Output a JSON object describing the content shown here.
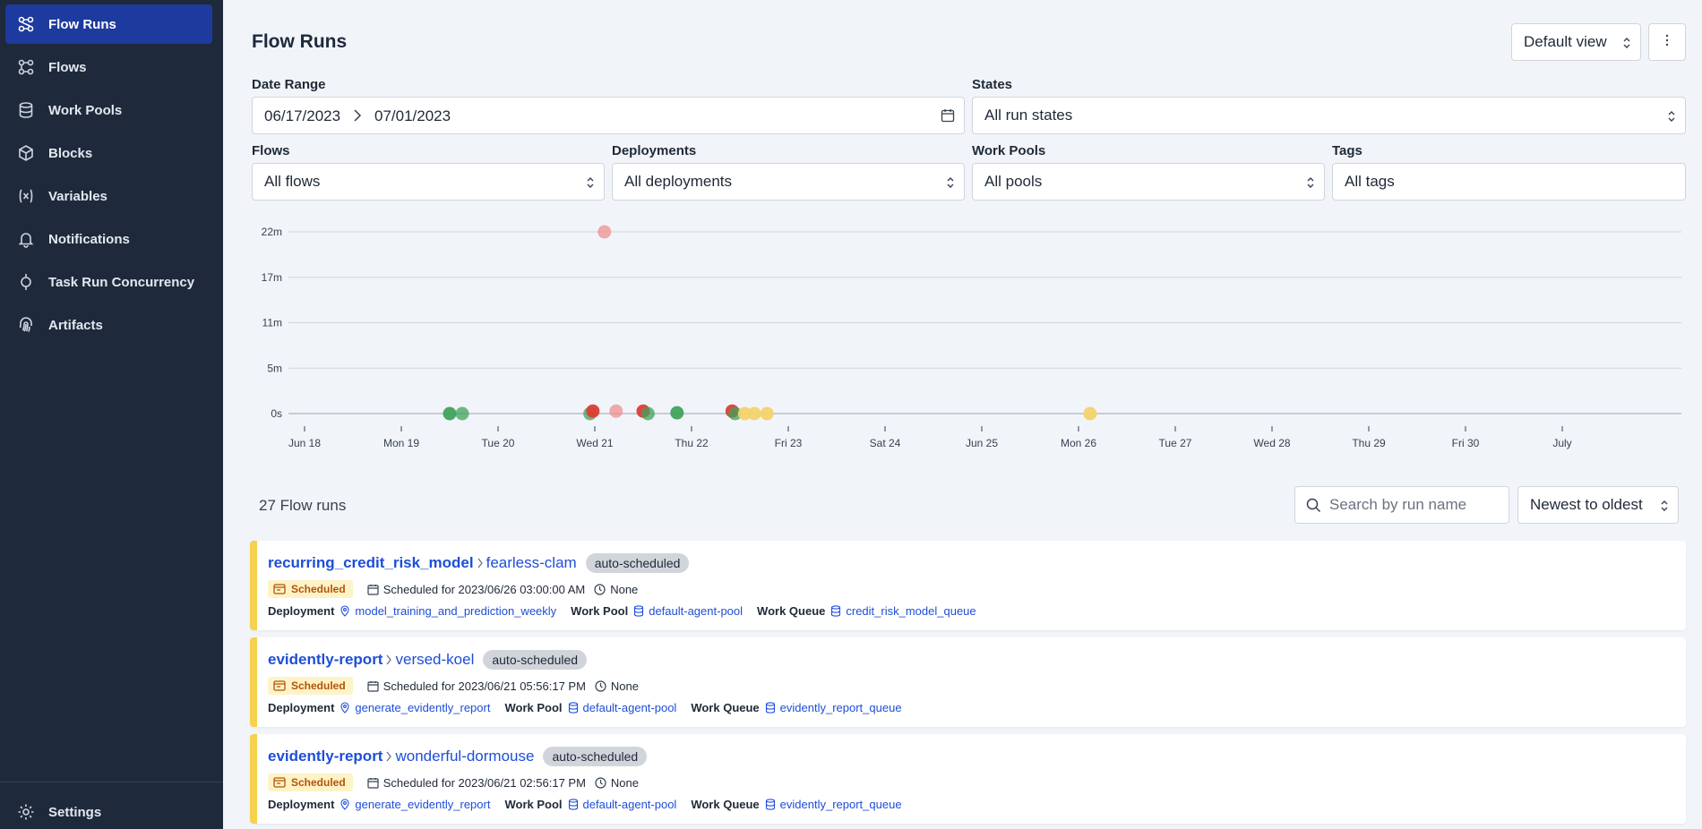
{
  "sidebar": {
    "items": [
      {
        "label": "Flow Runs",
        "icon": "flow-runs-icon",
        "active": true
      },
      {
        "label": "Flows",
        "icon": "flows-icon"
      },
      {
        "label": "Work Pools",
        "icon": "database-icon"
      },
      {
        "label": "Blocks",
        "icon": "cube-icon"
      },
      {
        "label": "Variables",
        "icon": "variable-icon"
      },
      {
        "label": "Notifications",
        "icon": "bell-icon"
      },
      {
        "label": "Task Run Concurrency",
        "icon": "concurrency-icon"
      },
      {
        "label": "Artifacts",
        "icon": "fingerprint-icon"
      }
    ],
    "settings_label": "Settings"
  },
  "header": {
    "title": "Flow Runs",
    "view_select": "Default view"
  },
  "filters": {
    "date_range_label": "Date Range",
    "date_start": "06/17/2023",
    "date_end": "07/01/2023",
    "states_label": "States",
    "states_value": "All run states",
    "flows_label": "Flows",
    "flows_value": "All flows",
    "deployments_label": "Deployments",
    "deployments_value": "All deployments",
    "work_pools_label": "Work Pools",
    "work_pools_value": "All pools",
    "tags_label": "Tags",
    "tags_value": "All tags"
  },
  "chart_data": {
    "type": "scatter",
    "y_ticks": [
      "22m",
      "17m",
      "11m",
      "5m",
      "0s"
    ],
    "x_ticks": [
      "Jun 18",
      "Mon 19",
      "Tue 20",
      "Wed 21",
      "Thu 22",
      "Fri 23",
      "Sat 24",
      "Jun 25",
      "Mon 26",
      "Tue 27",
      "Wed 28",
      "Thu 29",
      "Fri 30",
      "July"
    ],
    "ylim_minutes": [
      0,
      22
    ],
    "grid": true,
    "colors": {
      "completed": "#3fa35b",
      "failed": "#dc3d35",
      "scheduled": "#f3d26b",
      "crashed_light": "#ee8f8f"
    },
    "points": [
      {
        "day": 1.5,
        "minutes": 0,
        "state": "completed"
      },
      {
        "day": 1.63,
        "minutes": 0,
        "state": "completed",
        "faded": true
      },
      {
        "day": 2.95,
        "minutes": 0,
        "state": "completed",
        "faded": true
      },
      {
        "day": 2.98,
        "minutes": 0.3,
        "state": "failed"
      },
      {
        "day": 3.1,
        "minutes": 22,
        "state": "failed",
        "faded": true
      },
      {
        "day": 3.22,
        "minutes": 0.3,
        "state": "failed",
        "faded": true
      },
      {
        "day": 3.5,
        "minutes": 0.3,
        "state": "failed"
      },
      {
        "day": 3.55,
        "minutes": 0,
        "state": "completed",
        "faded": true
      },
      {
        "day": 3.85,
        "minutes": 0.1,
        "state": "completed"
      },
      {
        "day": 4.42,
        "minutes": 0.3,
        "state": "failed"
      },
      {
        "day": 4.45,
        "minutes": 0,
        "state": "completed",
        "faded": true
      },
      {
        "day": 4.55,
        "minutes": 0,
        "state": "scheduled"
      },
      {
        "day": 4.65,
        "minutes": 0,
        "state": "scheduled"
      },
      {
        "day": 4.78,
        "minutes": 0,
        "state": "scheduled"
      },
      {
        "day": 8.12,
        "minutes": 0,
        "state": "scheduled"
      }
    ]
  },
  "list": {
    "count_text": "27 Flow runs",
    "search_placeholder": "Search by run name",
    "sort_value": "Newest to oldest",
    "runs": [
      {
        "flow": "recurring_credit_risk_model",
        "name": "fearless-clam",
        "tag": "auto-scheduled",
        "state": "Scheduled",
        "scheduled_for": "Scheduled for 2023/06/26 03:00:00 AM",
        "duration": "None",
        "deployment_label": "Deployment",
        "deployment": "model_training_and_prediction_weekly",
        "work_pool_label": "Work Pool",
        "work_pool": "default-agent-pool",
        "work_queue_label": "Work Queue",
        "work_queue": "credit_risk_model_queue"
      },
      {
        "flow": "evidently-report",
        "name": "versed-koel",
        "tag": "auto-scheduled",
        "state": "Scheduled",
        "scheduled_for": "Scheduled for 2023/06/21 05:56:17 PM",
        "duration": "None",
        "deployment_label": "Deployment",
        "deployment": "generate_evidently_report",
        "work_pool_label": "Work Pool",
        "work_pool": "default-agent-pool",
        "work_queue_label": "Work Queue",
        "work_queue": "evidently_report_queue"
      },
      {
        "flow": "evidently-report",
        "name": "wonderful-dormouse",
        "tag": "auto-scheduled",
        "state": "Scheduled",
        "scheduled_for": "Scheduled for 2023/06/21 02:56:17 PM",
        "duration": "None",
        "deployment_label": "Deployment",
        "deployment": "generate_evidently_report",
        "work_pool_label": "Work Pool",
        "work_pool": "default-agent-pool",
        "work_queue_label": "Work Queue",
        "work_queue": "evidently_report_queue"
      }
    ]
  }
}
